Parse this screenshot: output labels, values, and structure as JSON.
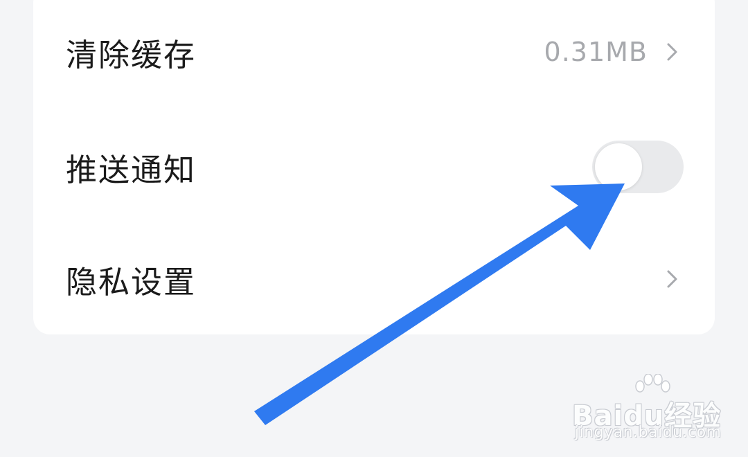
{
  "settings": {
    "clear_cache": {
      "label": "清除缓存",
      "value": "0.31MB"
    },
    "push_notifications": {
      "label": "推送通知",
      "enabled": false
    },
    "privacy_settings": {
      "label": "隐私设置"
    }
  },
  "icons": {
    "chevron": "chevron-right-icon",
    "annotation": "arrow-icon"
  },
  "colors": {
    "annotation_arrow": "#2f7af0",
    "toggle_off": "#e9eaec"
  },
  "watermark": {
    "logo": "Baidu经验",
    "url": "jingyan.baidu.com"
  }
}
